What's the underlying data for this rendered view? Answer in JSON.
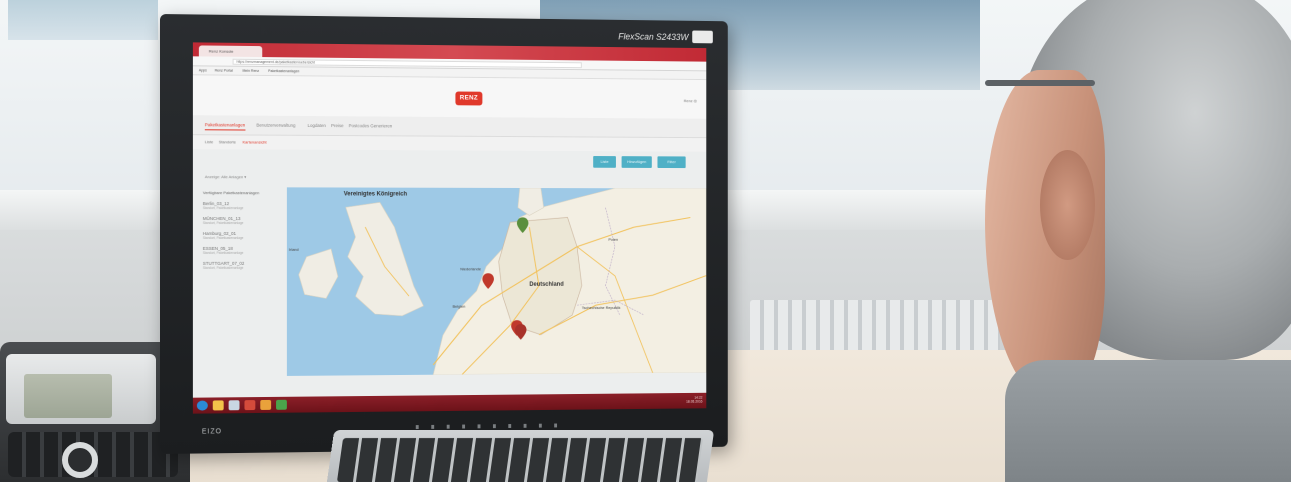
{
  "monitor": {
    "model": "FlexScan S2433W",
    "bezel_brand": "EIZO"
  },
  "browser": {
    "tab_title": "Renz Konsole",
    "url": "https://renzmanagement.de/paketkasten/uebersicht",
    "bookmarks": [
      "Apps",
      "Renz Portal",
      "Mein Renz",
      "Paketkastenanlagen"
    ]
  },
  "app": {
    "logo_text": "RENZ",
    "user_link": "Renz ◎",
    "nav": [
      "Paketkastenanlagen",
      "Benutzerverwaltung",
      "Logdaten",
      "Preise",
      "Postcodes Generieren"
    ],
    "nav_active": 0,
    "subnav": [
      "Liste",
      "Standorte",
      "Kartenansicht"
    ],
    "subnav_active": 2,
    "actions": [
      "Liste",
      "Hinzufügen",
      "Filter"
    ],
    "filter_label": "Anzeige: Alle Anlagen ▾",
    "sidebar_title": "Verfügbare Paketkastenanlagen",
    "sidebar_items": [
      {
        "name": "Berlin_03_12",
        "desc": "Standort, Paketkastenanlage"
      },
      {
        "name": "MÜNCHEN_01_13",
        "desc": "Standort, Paketkastenanlage"
      },
      {
        "name": "Hamburg_02_01",
        "desc": "Standort, Paketkastenanlage"
      },
      {
        "name": "ESSEN_05_18",
        "desc": "Standort, Paketkastenanlage"
      },
      {
        "name": "STUTTGART_07_02",
        "desc": "Standort, Paketkastenanlage"
      }
    ]
  },
  "map": {
    "labels": {
      "uk": "Vereinigtes Königreich",
      "ireland": "Irland",
      "germany": "Deutschland",
      "poland": "Polen",
      "netherlands": "Niederlande",
      "belgium": "Belgien",
      "czech": "Tschechische Republik"
    },
    "markers": [
      {
        "id": "hamburg",
        "color": "#5a8f3c"
      },
      {
        "id": "essen",
        "color": "#c0392b"
      },
      {
        "id": "stuttgart-a",
        "color": "#c0392b"
      },
      {
        "id": "stuttgart-b",
        "color": "#c0392b"
      }
    ]
  },
  "taskbar": {
    "time": "14:22",
    "date": "18.05.2016"
  },
  "colors": {
    "accent": "#e0392b",
    "button": "#4fb0c6",
    "water": "#9ec9e6",
    "land": "#f0ede4"
  }
}
